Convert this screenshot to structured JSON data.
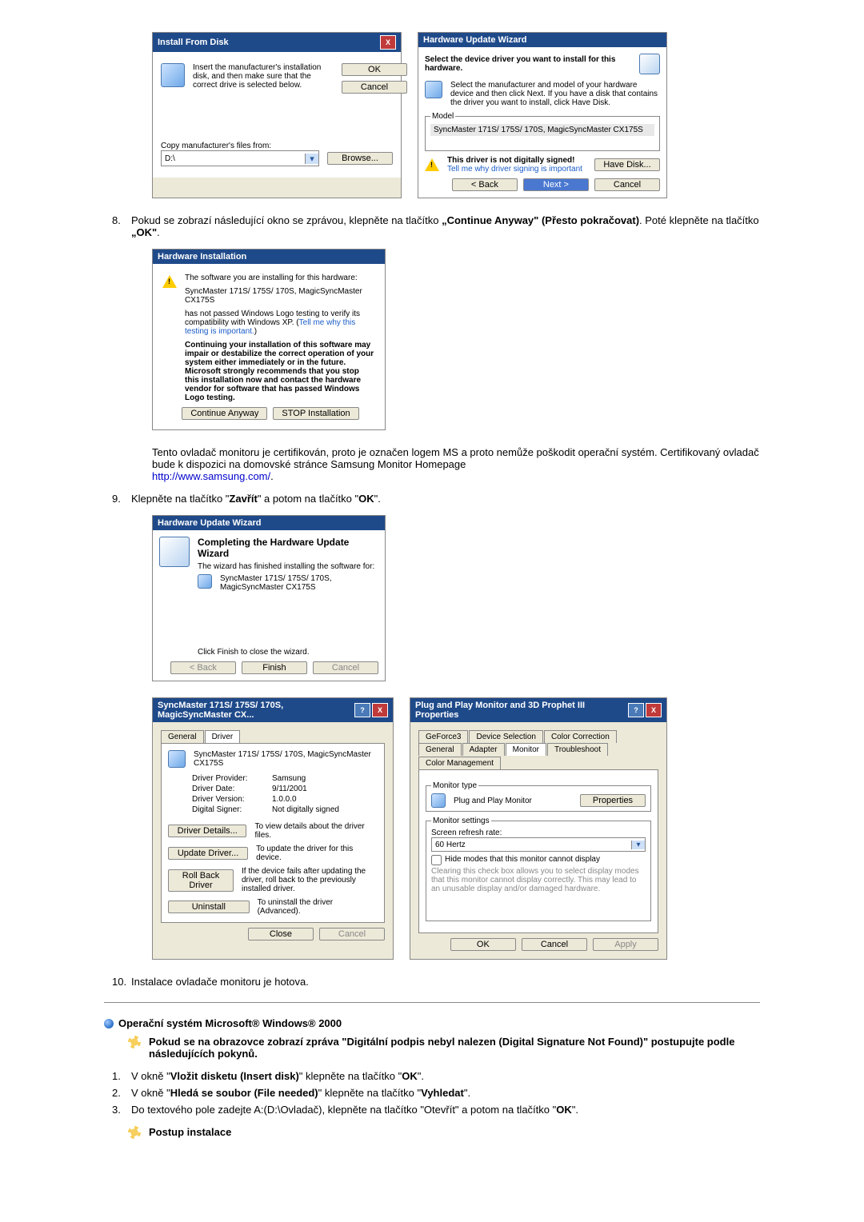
{
  "install_from_disk": {
    "title": "Install From Disk",
    "instruction": "Insert the manufacturer's installation disk, and then make sure that the correct drive is selected below.",
    "ok": "OK",
    "cancel": "Cancel",
    "copy_label": "Copy manufacturer's files from:",
    "drive": "D:\\",
    "browse": "Browse..."
  },
  "hw_update_wizard_top": {
    "title": "Hardware Update Wizard",
    "heading": "Select the device driver you want to install for this hardware.",
    "instruction": "Select the manufacturer and model of your hardware device and then click Next. If you have a disk that contains the driver you want to install, click Have Disk.",
    "model_label": "Model",
    "model_value": "SyncMaster 171S/ 175S/ 170S, MagicSyncMaster CX175S",
    "warn_text": "This driver is not digitally signed!",
    "warn_link": "Tell me why driver signing is important",
    "have_disk": "Have Disk...",
    "back": "< Back",
    "next": "Next >",
    "cancel": "Cancel"
  },
  "step8": {
    "num": "8.",
    "text_before": "Pokud se zobrazí následující okno se zprávou, klepněte na tlačítko ",
    "continue_anyway": "„Continue Anyway\"",
    "presto": " (Přesto pokračovat)",
    "pote": ". Poté klepněte na tlačítko ",
    "ok": "„OK\"",
    "dot": "."
  },
  "hw_installation": {
    "title": "Hardware Installation",
    "line1": "The software you are installing for this hardware:",
    "line2": "SyncMaster 171S/ 175S/ 170S, MagicSyncMaster CX175S",
    "line3": "has not passed Windows Logo testing to verify its compatibility with Windows XP. (",
    "link": "Tell me why this testing is important.",
    "line3_end": ")",
    "bold_para": "Continuing your installation of this software may impair or destabilize the correct operation of your system either immediately or in the future. Microsoft strongly recommends that you stop this installation now and contact the hardware vendor for software that has passed Windows Logo testing.",
    "continue_btn": "Continue Anyway",
    "stop_btn": "STOP Installation"
  },
  "cert_para": {
    "text": "Tento ovladač monitoru je certifikován, proto je označen logem MS a proto nemůže poškodit operační systém. Certifikovaný ovladač bude k dispozici na domovské stránce Samsung Monitor Homepage",
    "url": "http://www.samsung.com/",
    "dot": "."
  },
  "step9": {
    "num": "9.",
    "text_a": "Klepněte na tlačítko \"",
    "zavrit": "Zavřít",
    "text_b": "\" a potom na tlačítko \"",
    "ok": "OK",
    "text_c": "\"."
  },
  "hw_update_wizard_complete": {
    "title": "Hardware Update Wizard",
    "heading": "Completing the Hardware Update Wizard",
    "sub": "The wizard has finished installing the software for:",
    "device": "SyncMaster 171S/ 175S/ 170S, MagicSyncMaster CX175S",
    "click_finish": "Click Finish to close the wizard.",
    "back": "< Back",
    "finish": "Finish",
    "cancel": "Cancel"
  },
  "driver_props": {
    "title": "SyncMaster 171S/ 175S/ 170S, MagicSyncMaster CX...",
    "tab_general": "General",
    "tab_driver": "Driver",
    "device": "SyncMaster 171S/ 175S/ 170S, MagicSyncMaster CX175S",
    "provider_k": "Driver Provider:",
    "provider_v": "Samsung",
    "date_k": "Driver Date:",
    "date_v": "9/11/2001",
    "version_k": "Driver Version:",
    "version_v": "1.0.0.0",
    "signer_k": "Digital Signer:",
    "signer_v": "Not digitally signed",
    "details_btn": "Driver Details...",
    "details_txt": "To view details about the driver files.",
    "update_btn": "Update Driver...",
    "update_txt": "To update the driver for this device.",
    "rollback_btn": "Roll Back Driver",
    "rollback_txt": "If the device fails after updating the driver, roll back to the previously installed driver.",
    "uninstall_btn": "Uninstall",
    "uninstall_txt": "To uninstall the driver (Advanced).",
    "close": "Close",
    "cancel": "Cancel"
  },
  "pnp_props": {
    "title": "Plug and Play Monitor and 3D Prophet III Properties",
    "tabs": {
      "geforce": "GeForce3",
      "device_sel": "Device Selection",
      "color_corr": "Color Correction",
      "general": "General",
      "adapter": "Adapter",
      "monitor": "Monitor",
      "troubleshoot": "Troubleshoot",
      "color_mgmt": "Color Management"
    },
    "monitor_type": "Monitor type",
    "monitor_name": "Plug and Play Monitor",
    "properties": "Properties",
    "settings": "Monitor settings",
    "refresh_label": "Screen refresh rate:",
    "refresh_value": "60 Hertz",
    "hide_checkbox": "Hide modes that this monitor cannot display",
    "hide_note": "Clearing this check box allows you to select display modes that this monitor cannot display correctly. This may lead to an unusable display and/or damaged hardware.",
    "ok": "OK",
    "cancel": "Cancel",
    "apply": "Apply"
  },
  "step10": {
    "num": "10.",
    "text": "Instalace ovladače monitoru je hotova."
  },
  "win2000_heading": "Operační systém Microsoft® Windows® 2000",
  "win2000_intro_a": "Pokud se na obrazovce zobrazí zpráva \"Digitální podpis nebyl nalezen (Digital Signature Not Found)\" postupujte podle následujících pokynů.",
  "win2000_steps": [
    {
      "num": "1.",
      "a": "V okně \"",
      "b": "Vložit disketu (Insert disk)",
      "c": "\" klepněte na tlačítko \"",
      "d": "OK",
      "e": "\"."
    },
    {
      "num": "2.",
      "a": "V okně \"",
      "b": "Hledá se soubor (File needed)",
      "c": "\" klepněte na tlačítko \"",
      "d": "Vyhledat",
      "e": "\"."
    },
    {
      "num": "3.",
      "a": "Do textového pole zadejte A:(D:\\Ovladač), klepněte na tlačítko \"Otevřít\" a potom na tlačítko \"",
      "b": "",
      "c": "",
      "d": "OK",
      "e": "\"."
    }
  ],
  "postup": "Postup instalace"
}
